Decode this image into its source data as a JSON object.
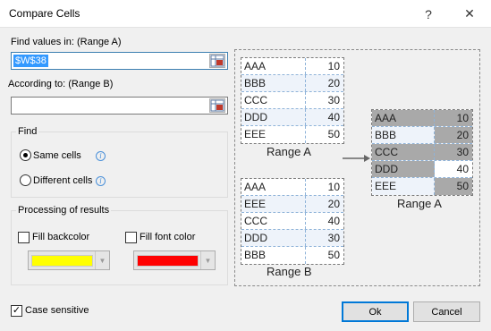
{
  "window": {
    "title": "Compare Cells",
    "help_glyph": "?",
    "close_glyph": "✕"
  },
  "range_a": {
    "label": "Find values in: (Range A)",
    "value": "$W$38"
  },
  "range_b": {
    "label": "According to: (Range B)",
    "value": ""
  },
  "find": {
    "title": "Find",
    "options": [
      {
        "label": "Same cells",
        "checked": true
      },
      {
        "label": "Different cells",
        "checked": false
      }
    ],
    "info_glyph": "i"
  },
  "processing": {
    "title": "Processing of results",
    "fill_backcolor": {
      "label": "Fill backcolor",
      "checked": false,
      "color": "#ffff00"
    },
    "fill_font_color": {
      "label": "Fill font color",
      "checked": false,
      "color": "#ff0000"
    }
  },
  "preview": {
    "range_a": {
      "caption": "Range A",
      "rows": [
        [
          "AAA",
          "10"
        ],
        [
          "BBB",
          "20"
        ],
        [
          "CCC",
          "30"
        ],
        [
          "DDD",
          "40"
        ],
        [
          "EEE",
          "50"
        ]
      ]
    },
    "range_b": {
      "caption": "Range B",
      "rows": [
        [
          "AAA",
          "10"
        ],
        [
          "EEE",
          "20"
        ],
        [
          "CCC",
          "40"
        ],
        [
          "DDD",
          "30"
        ],
        [
          "BBB",
          "50"
        ]
      ]
    },
    "result": {
      "caption": "Range A",
      "rows": [
        [
          "AAA",
          "10"
        ],
        [
          "BBB",
          "20"
        ],
        [
          "CCC",
          "30"
        ],
        [
          "DDD",
          "40"
        ],
        [
          "EEE",
          "50"
        ]
      ]
    },
    "arrow_glyph": "→"
  },
  "case_sensitive": {
    "label": "Case sensitive",
    "checked": true,
    "check_glyph": "✓"
  },
  "buttons": {
    "ok": "Ok",
    "cancel": "Cancel"
  },
  "icon_colors": {
    "range_picker": "#c0392b",
    "info": "#4a90d9",
    "default_button_border": "#0078d7"
  }
}
